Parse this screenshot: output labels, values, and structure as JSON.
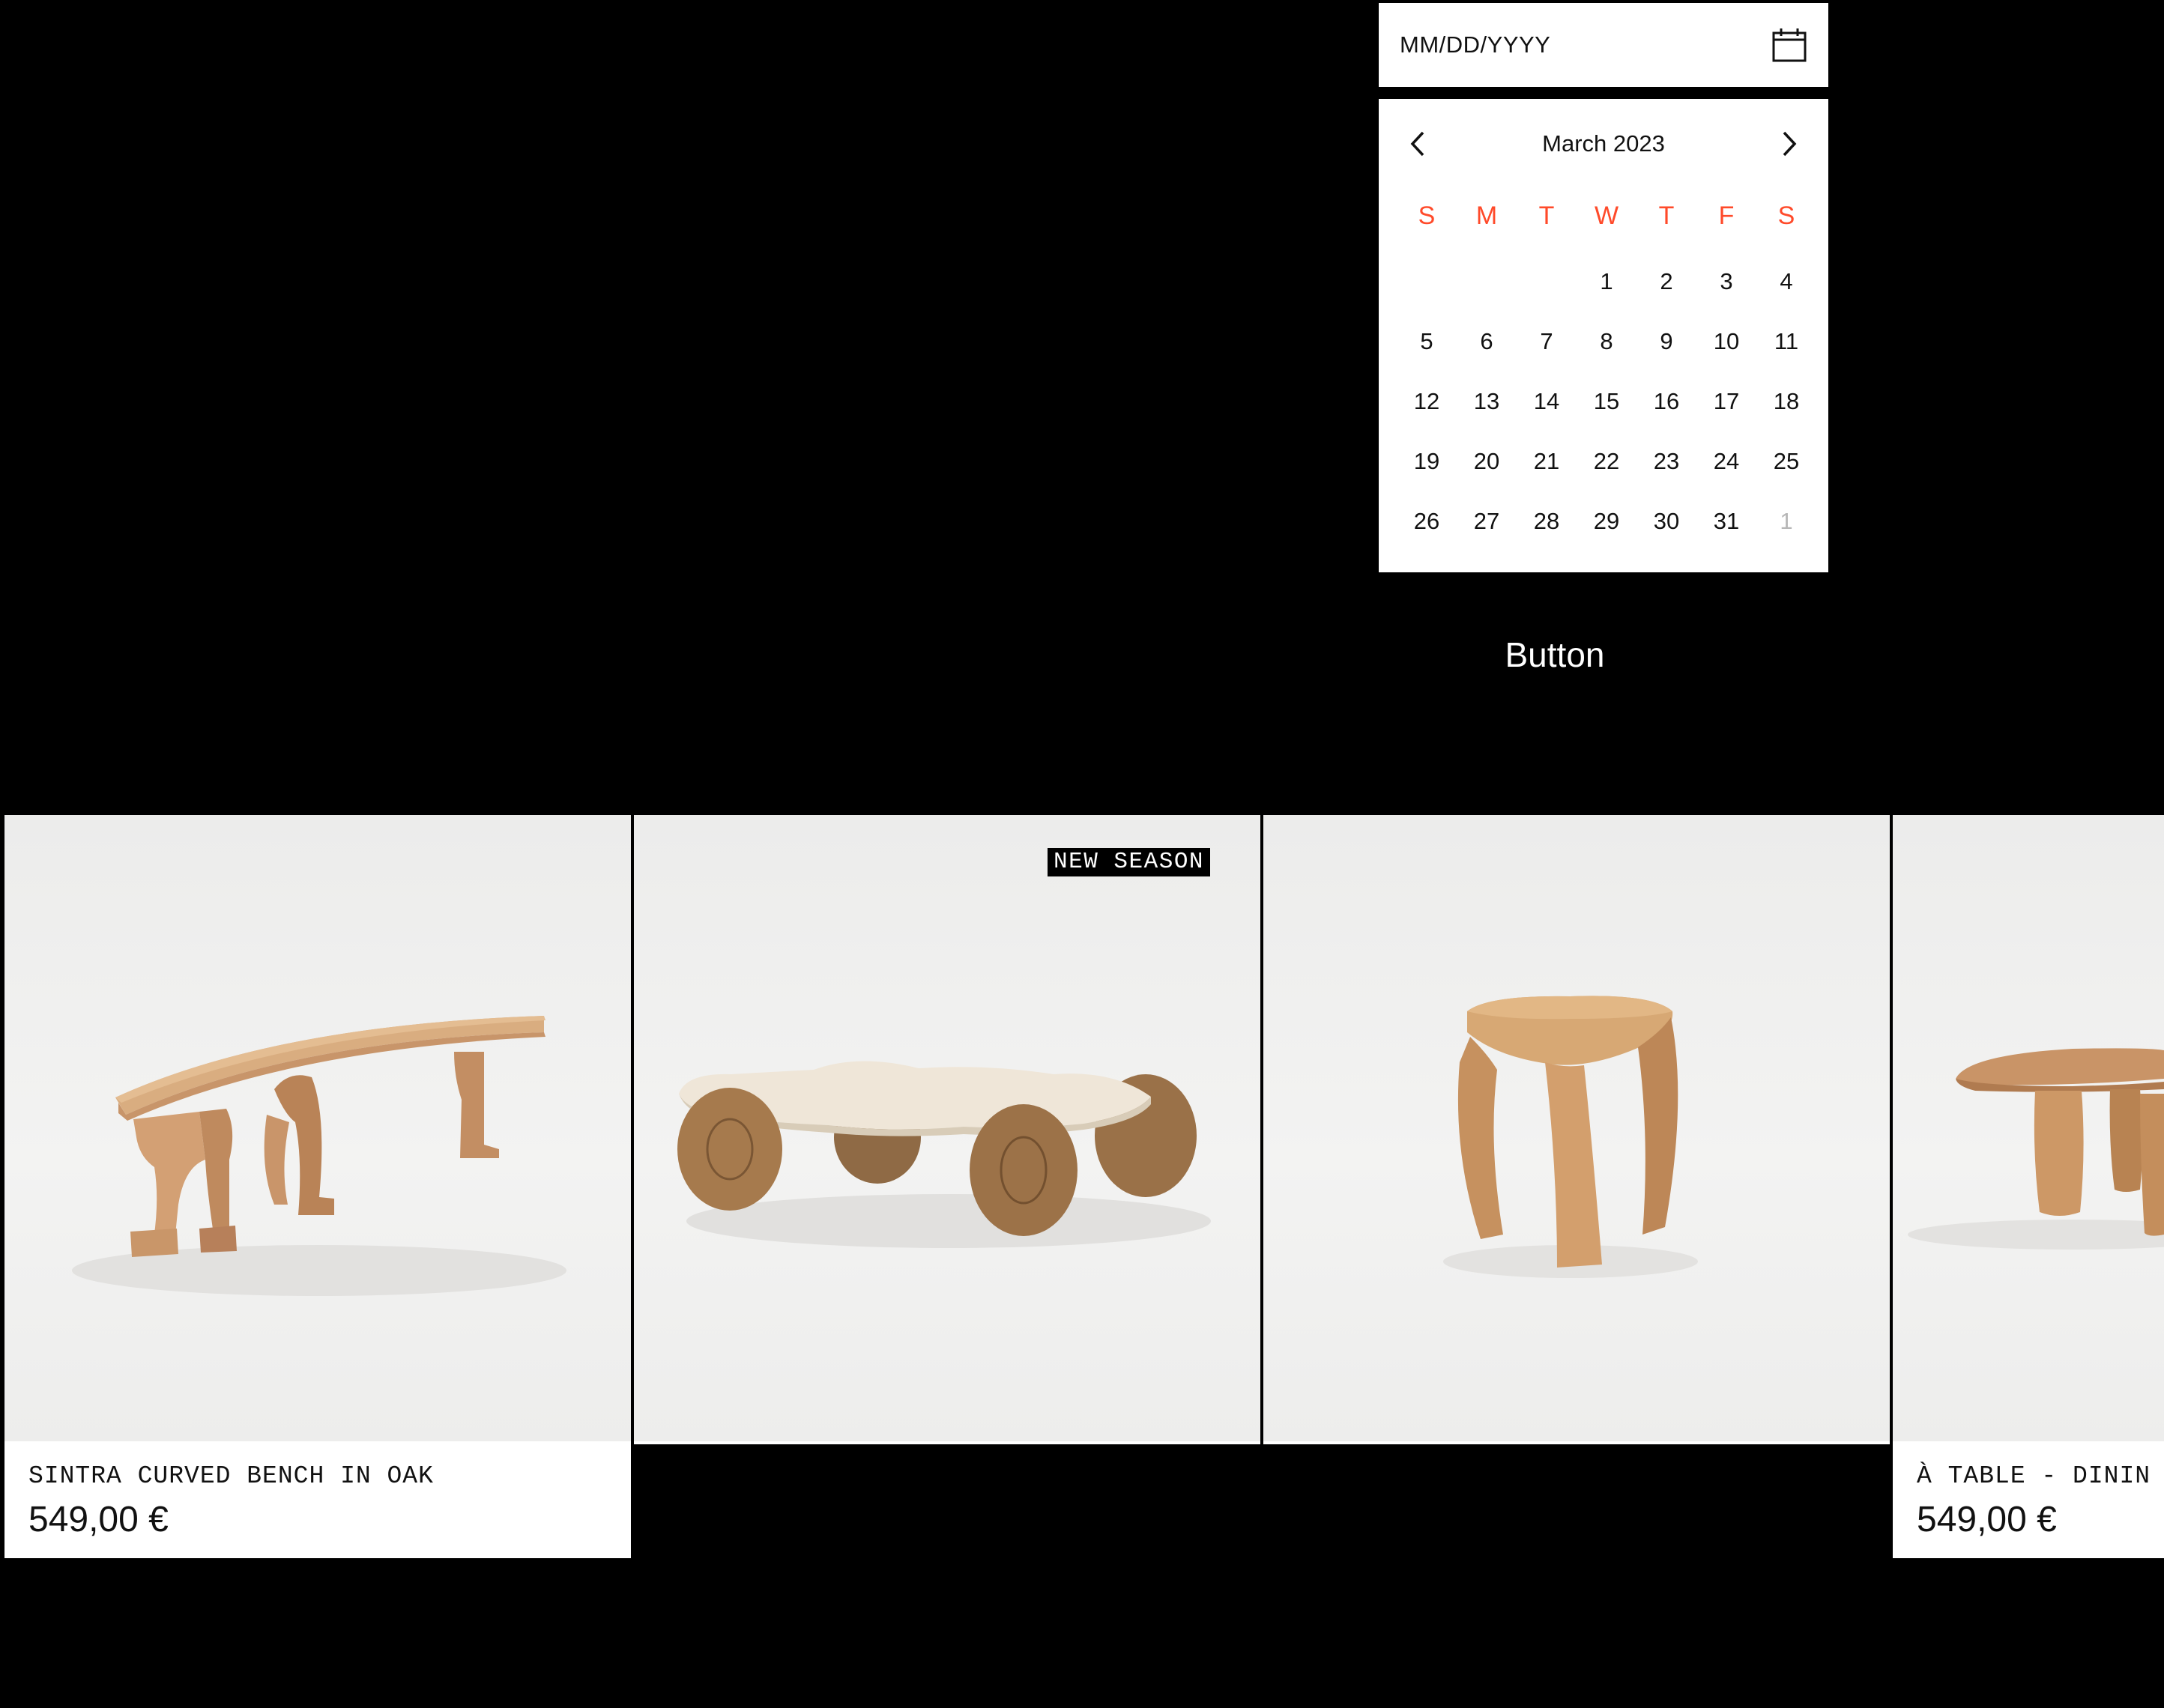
{
  "date_picker": {
    "placeholder": "MM/DD/YYYY",
    "calendar_icon": "calendar-icon",
    "month_label": "March 2023",
    "prev_icon": "chevron-left-icon",
    "next_icon": "chevron-right-icon",
    "weekdays": [
      "S",
      "M",
      "T",
      "W",
      "T",
      "F",
      "S"
    ],
    "weeks": [
      [
        "",
        "",
        "",
        "1",
        "2",
        "3",
        "4"
      ],
      [
        "5",
        "6",
        "7",
        "8",
        "9",
        "10",
        "11"
      ],
      [
        "12",
        "13",
        "14",
        "15",
        "16",
        "17",
        "18"
      ],
      [
        "19",
        "20",
        "21",
        "22",
        "23",
        "24",
        "25"
      ],
      [
        "26",
        "27",
        "28",
        "29",
        "30",
        "31",
        "1"
      ]
    ],
    "weekday_color": "#ff4a2a",
    "muted_color": "#b7b7b7"
  },
  "button": {
    "label": "Button"
  },
  "products": [
    {
      "name": "SINTRA CURVED BENCH IN OAK",
      "price": "549,00 €",
      "badge": ""
    },
    {
      "name": "",
      "price": "",
      "badge": "NEW SEASON"
    },
    {
      "name": "",
      "price": "",
      "badge": ""
    },
    {
      "name": "À TABLE - DININ",
      "price": "549,00 €",
      "badge": ""
    }
  ]
}
